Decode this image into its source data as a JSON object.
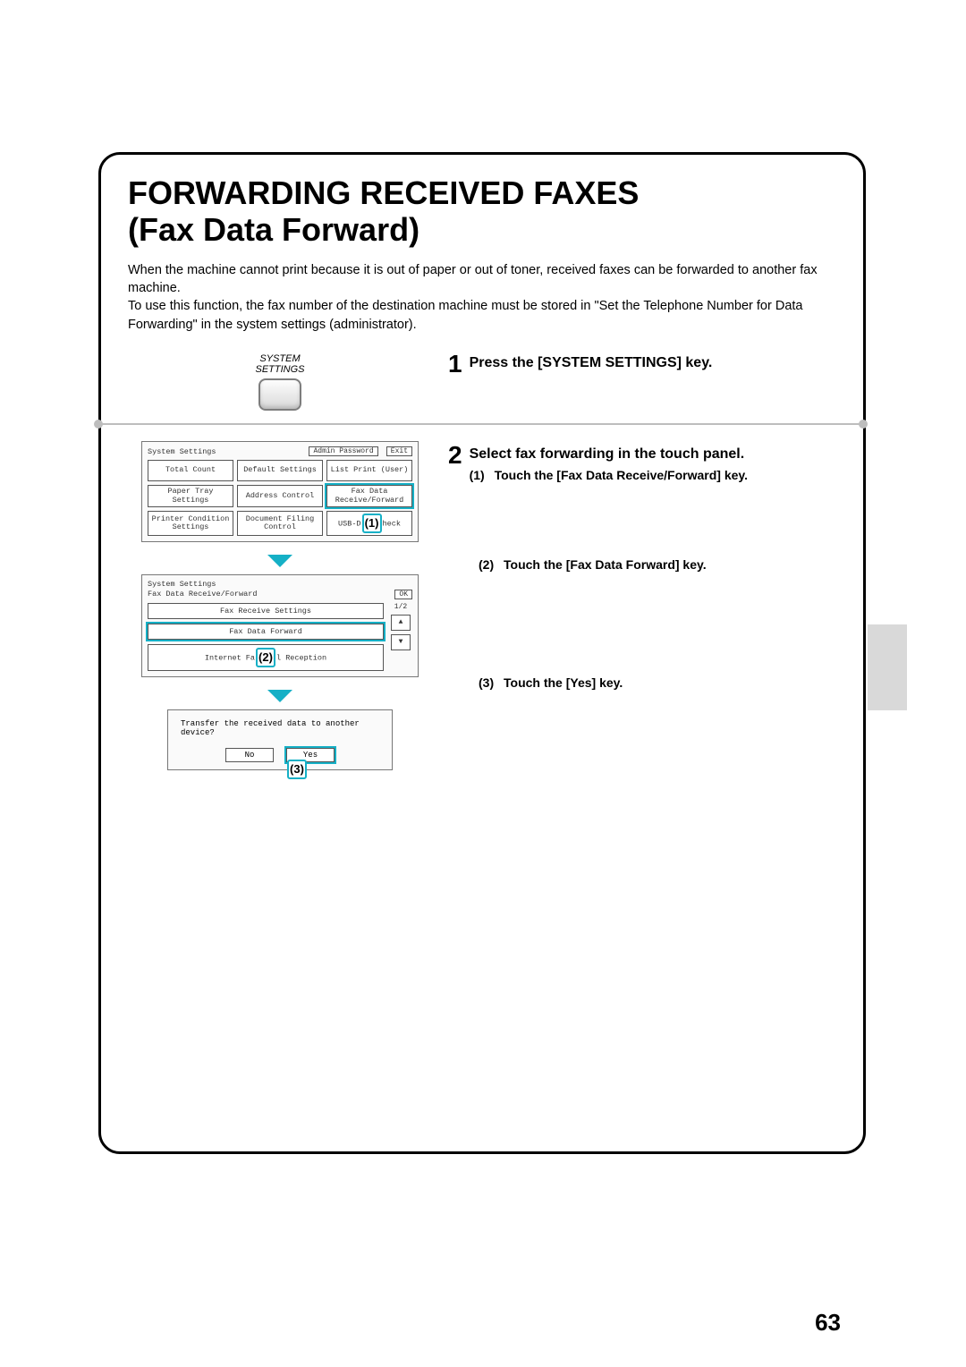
{
  "title_line1": "FORWARDING RECEIVED FAXES",
  "title_line2": "(Fax Data Forward)",
  "description": "When the machine cannot print because it is out of paper or out of toner, received faxes can be forwarded to another fax machine.\nTo use this function, the fax number of the destination machine must be stored in \"Set the Telephone Number for Data Forwarding\" in the system settings (administrator).",
  "step1": {
    "num": "1",
    "heading": "Press the [SYSTEM SETTINGS] key.",
    "key_label_line1": "SYSTEM",
    "key_label_line2": "SETTINGS"
  },
  "step2": {
    "num": "2",
    "heading": "Select fax forwarding in the touch panel.",
    "sub1_num": "(1)",
    "sub1_text": "Touch the [Fax Data Receive/Forward] key.",
    "sub2_num": "(2)",
    "sub2_text": "Touch the [Fax Data Forward] key.",
    "sub3_num": "(3)",
    "sub3_text": "Touch the [Yes] key."
  },
  "screen1": {
    "title": "System Settings",
    "btn_admin": "Admin Password",
    "btn_exit": "Exit",
    "cells": [
      "Total Count",
      "Default Settings",
      "List Print (User)",
      "Paper Tray Settings",
      "Address Control",
      "Fax Data Receive/Forward",
      "Printer Condition Settings",
      "Document Filing Control",
      "USB-Device Check"
    ],
    "callout": "(1)"
  },
  "screen2": {
    "title": "System Settings",
    "subtitle": "Fax Data Receive/Forward",
    "btn_ok": "OK",
    "page_ind": "1/2",
    "items": [
      "Fax Receive Settings",
      "Fax Data Forward",
      "Internet Fax Manual Reception"
    ],
    "callout": "(2)"
  },
  "dialog": {
    "text": "Transfer the received data to another device?",
    "no": "No",
    "yes": "Yes",
    "callout": "(3)"
  },
  "page_number": "63"
}
